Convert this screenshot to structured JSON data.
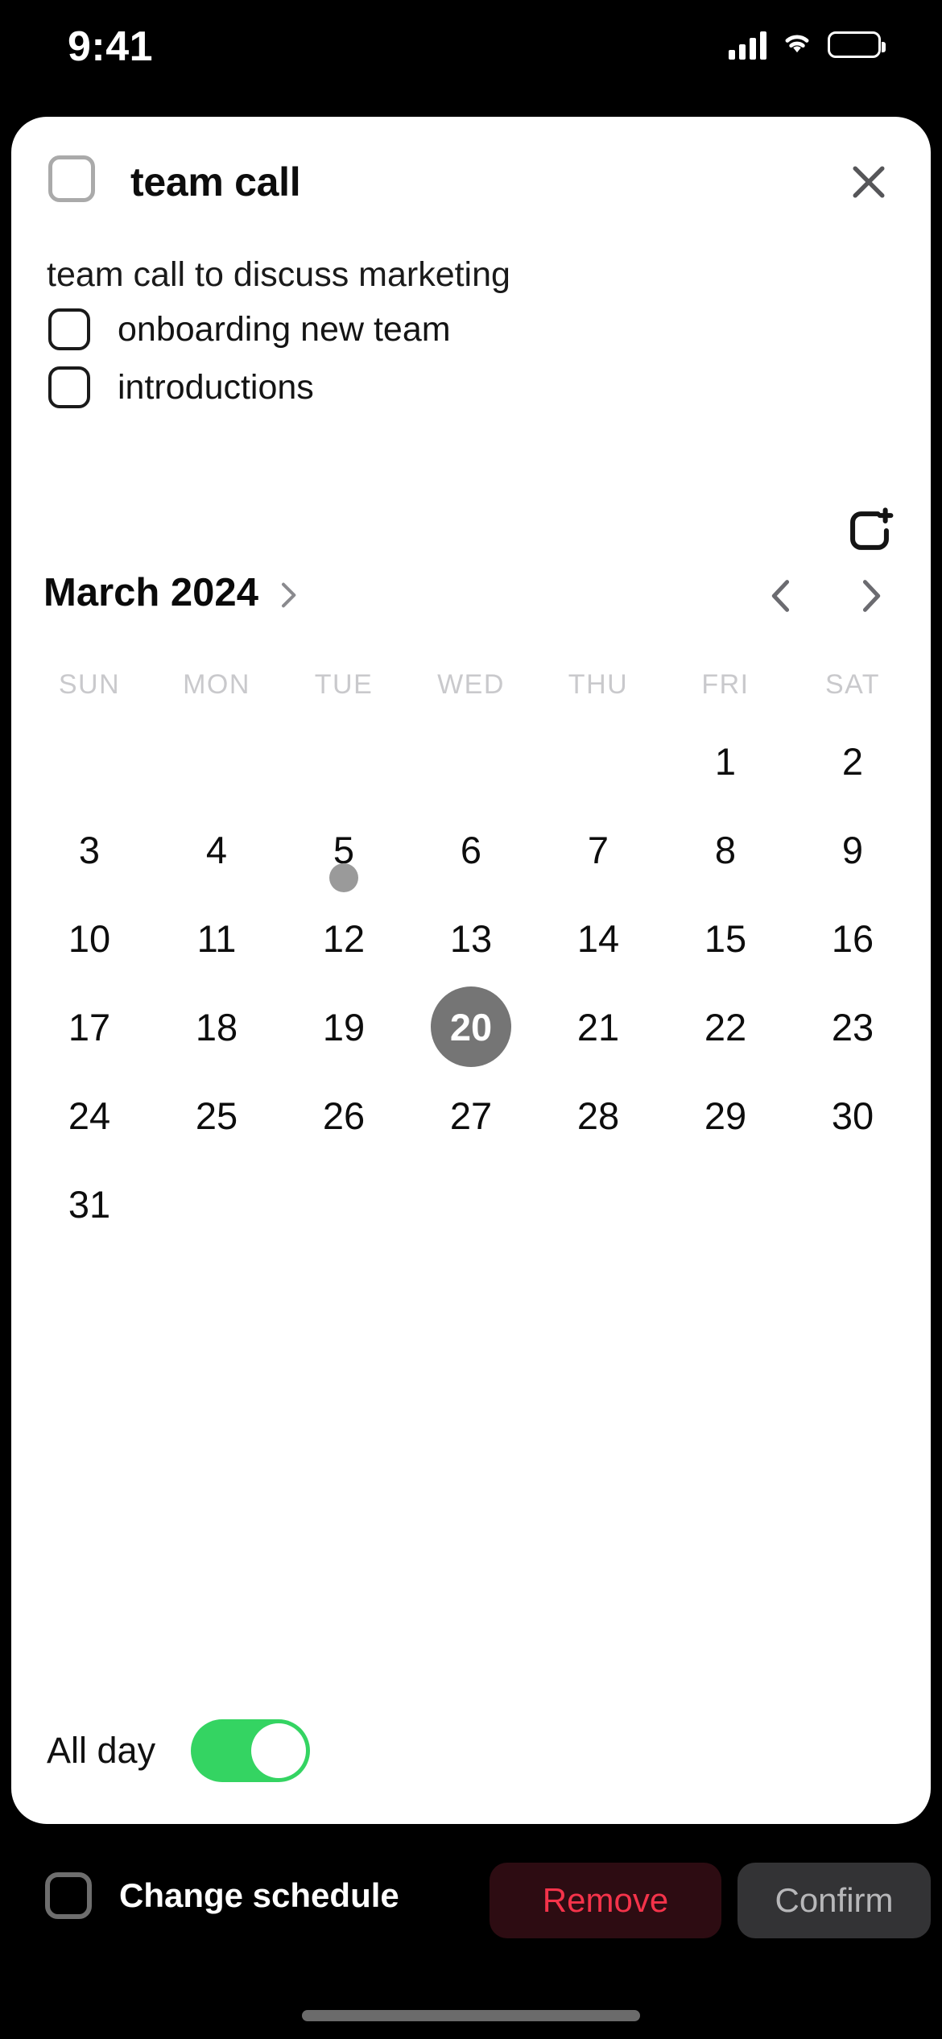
{
  "status_bar": {
    "time": "9:41",
    "icons": [
      "cellular-signal-icon",
      "wifi-icon",
      "battery-icon"
    ]
  },
  "task": {
    "title": "team call",
    "description": "team call to discuss marketing",
    "checkbox_checked": false,
    "close_label": "close",
    "subtasks": [
      {
        "label": "onboarding new team",
        "checked": false
      },
      {
        "label": "introductions",
        "checked": false
      }
    ]
  },
  "repeat_button": {
    "icon": "repeat-add-icon"
  },
  "calendar": {
    "month_label": "March 2024",
    "month_chevron": "chevron-right-icon",
    "prev_icon": "chevron-left-icon",
    "next_icon": "chevron-right-icon",
    "weekdays": [
      "SUN",
      "MON",
      "TUE",
      "WED",
      "THU",
      "FRI",
      "SAT"
    ],
    "weeks": [
      [
        "",
        "",
        "",
        "",
        "",
        "1",
        "2"
      ],
      [
        "3",
        "4",
        "5",
        "6",
        "7",
        "8",
        "9"
      ],
      [
        "10",
        "11",
        "12",
        "13",
        "14",
        "15",
        "16"
      ],
      [
        "17",
        "18",
        "19",
        "20",
        "21",
        "22",
        "23"
      ],
      [
        "24",
        "25",
        "26",
        "27",
        "28",
        "29",
        "30"
      ],
      [
        "31",
        "",
        "",
        "",
        "",
        "",
        ""
      ]
    ],
    "selected_day": "20",
    "marked_days": [
      "5"
    ]
  },
  "all_day": {
    "label": "All day",
    "enabled": true,
    "color": "#34d462"
  },
  "bottom_bar": {
    "change_schedule_label": "Change schedule",
    "change_schedule_checked": false,
    "remove_label": "Remove",
    "remove_color": "#f4334a",
    "confirm_label": "Confirm",
    "confirm_color": "#b7b7b9"
  }
}
